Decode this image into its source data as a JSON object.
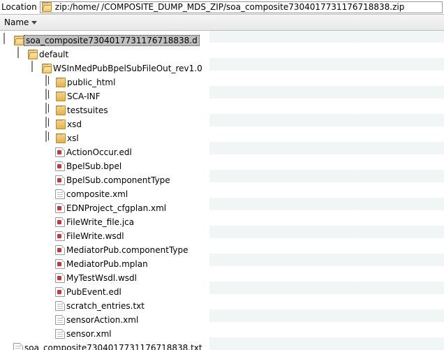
{
  "location": {
    "label": "Location",
    "path_prefix": "zip:/home/",
    "path_suffix": "/COMPOSITE_DUMP_MDS_ZIP/soa_composite7304017731176718838.zip"
  },
  "header": {
    "name_col": "Name"
  },
  "tree": {
    "root": "soa_composite7304017731176718838.d",
    "l1": "default",
    "l2": "WSInMedPubBpelSubFileOut_rev1.0",
    "folders": [
      "public_html",
      "SCA-INF",
      "testsuites",
      "xsd",
      "xsl"
    ],
    "files": [
      {
        "name": "ActionOccur.edl",
        "kind": "red"
      },
      {
        "name": "BpelSub.bpel",
        "kind": "red"
      },
      {
        "name": "BpelSub.componentType",
        "kind": "red"
      },
      {
        "name": "composite.xml",
        "kind": "gray"
      },
      {
        "name": "EDNProject_cfgplan.xml",
        "kind": "red"
      },
      {
        "name": "FileWrite_file.jca",
        "kind": "red"
      },
      {
        "name": "FileWrite.wsdl",
        "kind": "red"
      },
      {
        "name": "MediatorPub.componentType",
        "kind": "red"
      },
      {
        "name": "MediatorPub.mplan",
        "kind": "red"
      },
      {
        "name": "MyTestWsdl.wsdl",
        "kind": "red"
      },
      {
        "name": "PubEvent.edl",
        "kind": "red"
      },
      {
        "name": "scratch_entries.txt",
        "kind": "gray"
      },
      {
        "name": "sensorAction.xml",
        "kind": "gray"
      },
      {
        "name": "sensor.xml",
        "kind": "gray"
      }
    ],
    "sibling_file": "soa_composite7304017731176718838.txt"
  }
}
